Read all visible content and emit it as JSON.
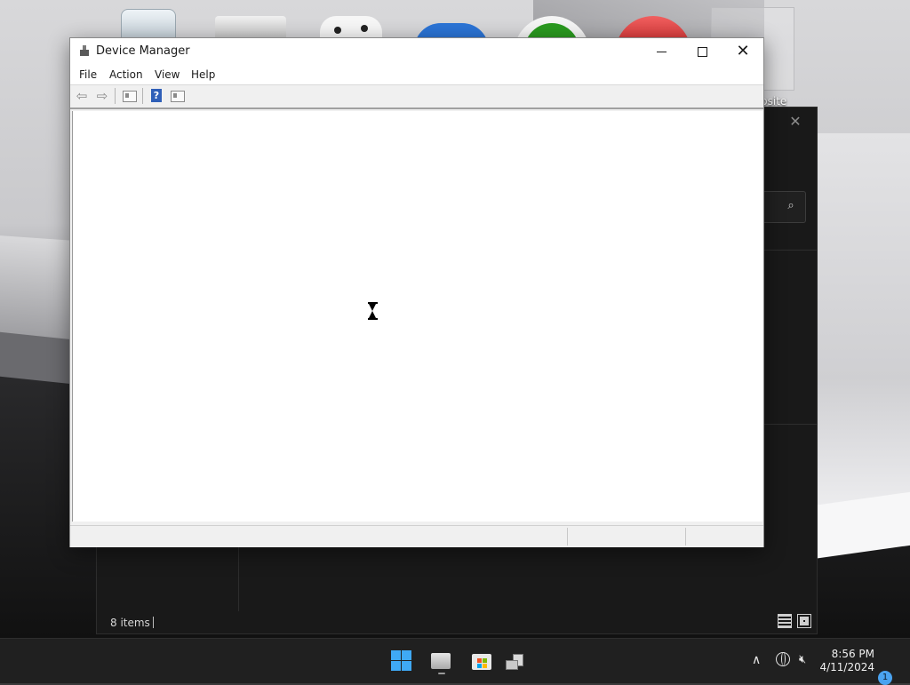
{
  "desktop": {
    "website_label": "bsite"
  },
  "device_manager": {
    "title": "Device Manager",
    "menu": [
      "File",
      "Action",
      "View",
      "Help"
    ],
    "toolbar_icons": [
      "back-icon",
      "forward-icon",
      "properties-icon",
      "help-icon",
      "view-icon"
    ],
    "content_state": "loading"
  },
  "explorer": {
    "status_text": "8 items"
  },
  "taskbar": {
    "apps": [
      "start-icon",
      "file-explorer-icon",
      "microsoft-store-icon",
      "device-manager-icon"
    ],
    "clock_time": "8:56 PM",
    "clock_date": "4/11/2024",
    "notification_count": "1"
  },
  "colors": {
    "accent": "#3fa9f5",
    "taskbar_bg": "#202020",
    "explorer_bg": "#191919"
  }
}
